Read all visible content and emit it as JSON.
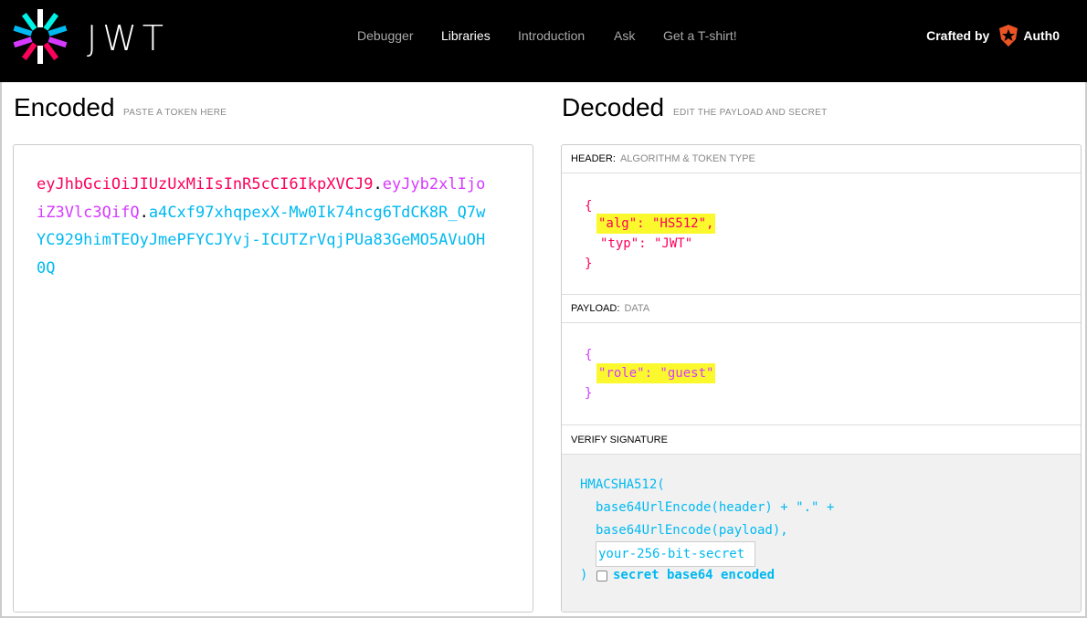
{
  "nav": {
    "logo_text": "JWT",
    "items": [
      {
        "label": "Debugger"
      },
      {
        "label": "Libraries"
      },
      {
        "label": "Introduction"
      },
      {
        "label": "Ask"
      },
      {
        "label": "Get a T-shirt!"
      }
    ],
    "active": "Libraries",
    "crafted_label": "Crafted by",
    "brand": "Auth0"
  },
  "encoded": {
    "title": "Encoded",
    "subtitle": "PASTE A TOKEN HERE",
    "token_header": "eyJhbGciOiJIUzUxMiIsInR5cCI6IkpXVCJ9",
    "token_payload": "eyJyb2xlIjoiZ3Vlc3QifQ",
    "token_signature": "a4Cxf97xhqpexX-Mw0Ik74ncg6TdCK8R_Q7wYC929himTEOyJmePFYCJYvj-ICUTZrVqjPUa83GeMO5AVuOH0Q"
  },
  "decoded": {
    "title": "Decoded",
    "subtitle": "EDIT THE PAYLOAD AND SECRET",
    "header_label": "HEADER:",
    "header_sub": "ALGORITHM & TOKEN TYPE",
    "header_json": {
      "open": "{",
      "line1": "\"alg\": \"HS512\",",
      "line2": "\"typ\": \"JWT\"",
      "close": "}"
    },
    "payload_label": "PAYLOAD:",
    "payload_sub": "DATA",
    "payload_json": {
      "open": "{",
      "line1": "\"role\": \"guest\"",
      "close": "}"
    },
    "verify_label": "VERIFY SIGNATURE",
    "signature": {
      "line1": "HMACSHA512(",
      "line2": "base64UrlEncode(header) + \".\" +",
      "line3": "base64UrlEncode(payload),",
      "secret_placeholder": "your-256-bit-secret",
      "close": ")",
      "checkbox_label": "secret base64 encoded"
    }
  },
  "colors": {
    "header": "#fb015b",
    "payload": "#d63aff",
    "signature": "#00b9f1",
    "highlight": "#fbf92d"
  }
}
